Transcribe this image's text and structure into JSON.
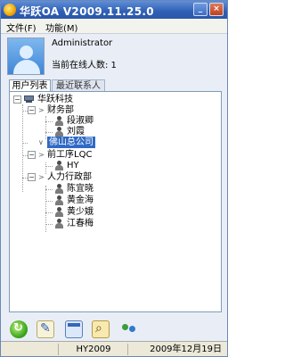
{
  "window": {
    "title": "华跃OA V2009.11.25.0",
    "minimize_label": "_",
    "close_label": "×"
  },
  "menu": {
    "file": "文件(F)",
    "function": "功能(M)"
  },
  "user": {
    "name": "Administrator",
    "online_count_text": "当前在线人数: 1"
  },
  "tabs": {
    "users": "用户列表",
    "recent": "最近联系人"
  },
  "tree": {
    "root": "华跃科技",
    "groups": [
      {
        "label": "财务部",
        "members": [
          "段淑卿",
          "刘霞"
        ]
      },
      {
        "label": "佛山总公司",
        "selected": true,
        "members": []
      },
      {
        "label": "前工序LQC",
        "members": [
          "HY"
        ]
      },
      {
        "label": "人力行政部",
        "members": [
          "陈宜晓",
          "黄金海",
          "黄少娥",
          "江春梅"
        ]
      }
    ]
  },
  "status": {
    "left": "",
    "user": "HY2009",
    "date": "2009年12月19日"
  }
}
